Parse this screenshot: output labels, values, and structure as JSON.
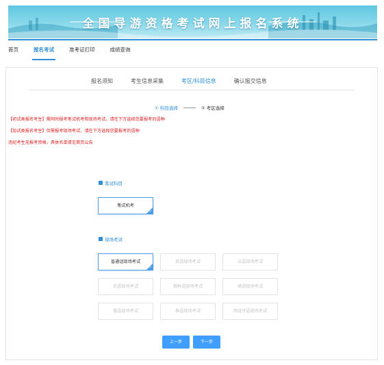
{
  "banner": {
    "title": "全国导游资格考试网上报名系统"
  },
  "nav": [
    {
      "label": "首页",
      "active": false
    },
    {
      "label": "报名考试",
      "active": true
    },
    {
      "label": "准考证打印",
      "active": false
    },
    {
      "label": "成绩查询",
      "active": false
    }
  ],
  "steps": [
    {
      "label": "报名须知",
      "active": false
    },
    {
      "label": "考生信息采集",
      "active": false
    },
    {
      "label": "考区/科目信息",
      "active": true
    },
    {
      "label": "确认报交信息",
      "active": false
    }
  ],
  "sub_steps": {
    "step1": "① 科目选择",
    "step2": "② 考区选择"
  },
  "notices": [
    "【初试类报名考生】需同时报考笔试机考和现场考试，请在下方选择您要报考的语种",
    "【加试类报名考生】仅需报考现场考试，请在下方选择您要报考的语种",
    "违纪考生无报考资格，具体名单请见首页公告"
  ],
  "written": {
    "label": "笔试科目",
    "options": [
      {
        "label": "笔试机考",
        "selected": true
      }
    ]
  },
  "oral": {
    "label": "现场考试",
    "options": [
      {
        "label": "普通话现场考试",
        "selected": true
      },
      {
        "label": "英语现场考试",
        "selected": false
      },
      {
        "label": "法语现场考试",
        "selected": false
      },
      {
        "label": "日语现场考试",
        "selected": false
      },
      {
        "label": "朝鲜语现场考试",
        "selected": false
      },
      {
        "label": "德语现场考试",
        "selected": false
      },
      {
        "label": "俄语现场考试",
        "selected": false
      },
      {
        "label": "泰语现场考试",
        "selected": false
      },
      {
        "label": "西班牙语现场考试",
        "selected": false
      }
    ]
  },
  "buttons": {
    "prev": "上一步",
    "next": "下一步"
  },
  "colors": {
    "primary": "#2f8fd8",
    "button": "#409eff",
    "notice": "#e02020"
  }
}
